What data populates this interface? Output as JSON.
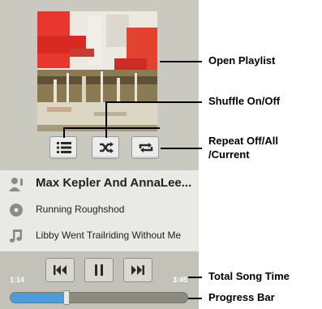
{
  "player": {
    "artist": "Max Kepler And AnnaLee...",
    "album": "Running Roughshod",
    "track": "Libby Went Trailriding Without  Me",
    "elapsed": "1:14",
    "total": "3:45",
    "progress_fraction": 0.32
  },
  "controls": {
    "playlist_icon": "list-icon",
    "shuffle_icon": "shuffle-icon",
    "repeat_icon": "repeat-icon",
    "prev_icon": "skip-previous-icon",
    "pause_icon": "pause-icon",
    "next_icon": "skip-next-icon"
  },
  "callouts": {
    "open_playlist": "Open Playlist",
    "shuffle": "Shuffle On/Off",
    "repeat_line1": "Repeat Off/All",
    "repeat_line2": "/Current",
    "total_time": "Total Song Time",
    "progress_bar": "Progress Bar"
  },
  "colors": {
    "progress": "#4f9ad8",
    "panel_bg": "#c9c9bf"
  }
}
